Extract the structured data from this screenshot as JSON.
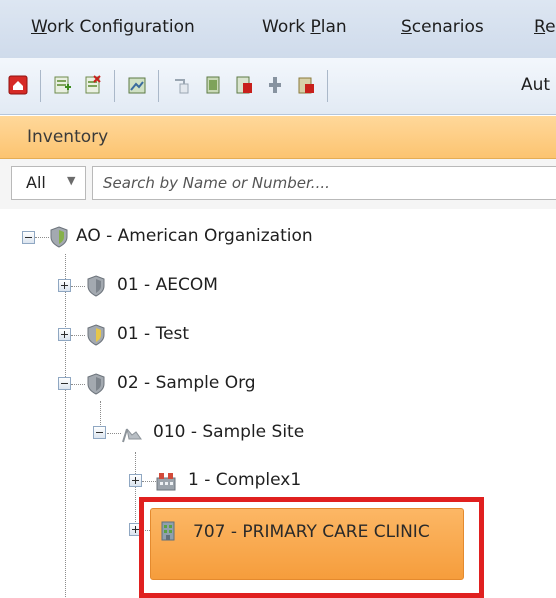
{
  "menubar": {
    "items": [
      {
        "label": "Work Configuration",
        "mnemonic": "W"
      },
      {
        "label": "Work Plan",
        "mnemonic": "P"
      },
      {
        "label": "Scenarios",
        "mnemonic": "S"
      },
      {
        "label": "Re",
        "mnemonic": "R"
      }
    ]
  },
  "toolbar": {
    "icons": [
      "home-icon",
      "add-record-icon",
      "delete-record-icon",
      "edit-record-icon",
      "copy-icon",
      "book-icon",
      "export-icon",
      "move-icon",
      "print-icon"
    ],
    "auto_label": "Aut"
  },
  "panel": {
    "title": "Inventory"
  },
  "search": {
    "filter_value": "All",
    "placeholder": "Search by Name or Number...."
  },
  "tree": {
    "nodes": [
      {
        "label": "AO - American Organization",
        "icon": "shield-icon",
        "expanded": true
      },
      {
        "label": "01 - AECOM",
        "icon": "shield-icon",
        "expanded": false
      },
      {
        "label": "01 - Test",
        "icon": "shield-icon",
        "expanded": false
      },
      {
        "label": "02 - Sample Org",
        "icon": "shield-icon",
        "expanded": true
      },
      {
        "label": "010 - Sample Site",
        "icon": "flag-icon",
        "expanded": true
      },
      {
        "label": "1 - Complex1",
        "icon": "complex-icon",
        "expanded": false
      },
      {
        "label": "707 - PRIMARY CARE CLINIC",
        "icon": "building-icon",
        "expanded": false,
        "selected": true
      }
    ]
  },
  "colors": {
    "selection": "#f8a544",
    "highlight_border": "#e0201f",
    "panel_header": "#fcc471"
  }
}
